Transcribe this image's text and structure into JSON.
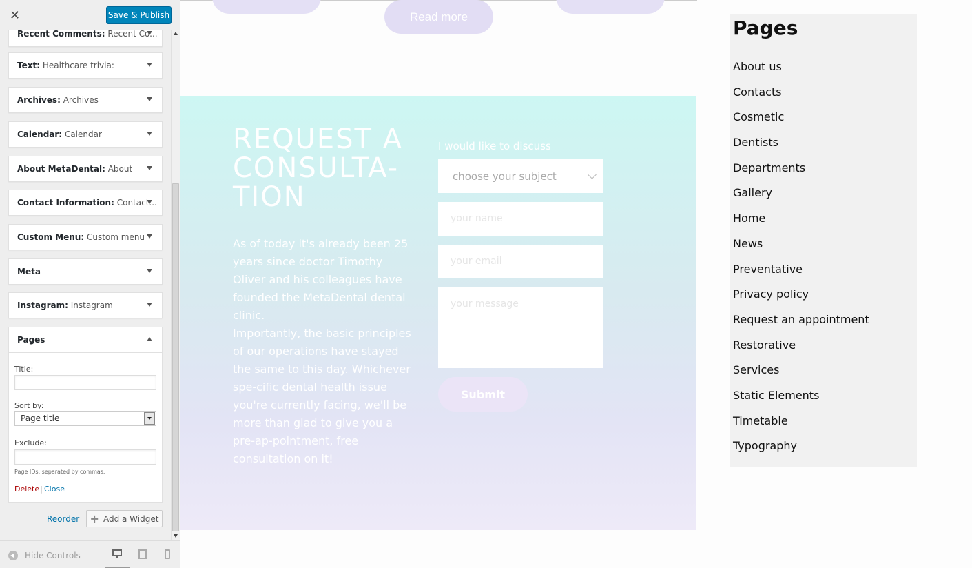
{
  "topbar": {
    "close_glyph": "✕",
    "save_label": "Save & Publish"
  },
  "widgets": [
    {
      "title": "Recent Comments:",
      "subtitle": "Recent Co..."
    },
    {
      "title": "Text:",
      "subtitle": "Healthcare trivia:"
    },
    {
      "title": "Archives:",
      "subtitle": "Archives"
    },
    {
      "title": "Calendar:",
      "subtitle": "Calendar"
    },
    {
      "title": "About MetaDental:",
      "subtitle": "About"
    },
    {
      "title": "Contact Information:",
      "subtitle": "Contact..."
    },
    {
      "title": "Custom Menu:",
      "subtitle": "Custom menu"
    },
    {
      "title": "Meta",
      "subtitle": ""
    },
    {
      "title": "Instagram:",
      "subtitle": "Instagram"
    },
    {
      "title": "Pages",
      "subtitle": ""
    }
  ],
  "pages_form": {
    "title_label": "Title:",
    "title_value": "",
    "sort_label": "Sort by:",
    "sort_value": "Page title",
    "exclude_label": "Exclude:",
    "exclude_value": "",
    "help_text": "Page IDs, separated by commas.",
    "delete_label": "Delete",
    "separator": "|",
    "close_label": "Close"
  },
  "actions": {
    "reorder_label": "Reorder",
    "add_widget_label": "Add a Widget"
  },
  "footer": {
    "hide_controls_label": "Hide Controls"
  },
  "preview": {
    "read_more_label": "Read more",
    "consult_title": "REQUEST A CONSULTA-TION",
    "paragraph_1": "As of today it's already been 25 years since doctor Timothy Oliver and his colleagues have founded the MetaDental dental clinic.",
    "paragraph_2": "Importantly, the basic principles of our operations have stayed the same to this day. Whichever spe-cific dental health issue you're currently facing, we'll be more than glad to give you a pre-ap-pointment, free consultation on it!",
    "discuss_label": "I would like to discuss",
    "subject_placeholder": "choose your subject",
    "name_placeholder": "your name",
    "email_placeholder": "your email",
    "message_placeholder": "your message",
    "submit_label": "Submit"
  },
  "pages_widget": {
    "heading": "Pages",
    "items": [
      "About us",
      "Contacts",
      "Cosmetic",
      "Dentists",
      "Departments",
      "Gallery",
      "Home",
      "News",
      "Preventative",
      "Privacy policy",
      "Request an appointment",
      "Restorative",
      "Services",
      "Static Elements",
      "Timetable",
      "Typography"
    ]
  },
  "colors": {
    "accent": "#0085ba",
    "link": "#0073aa",
    "delete": "#aa0000",
    "consult_top": "#cdf7f3",
    "consult_bottom": "#eeeaf8"
  }
}
